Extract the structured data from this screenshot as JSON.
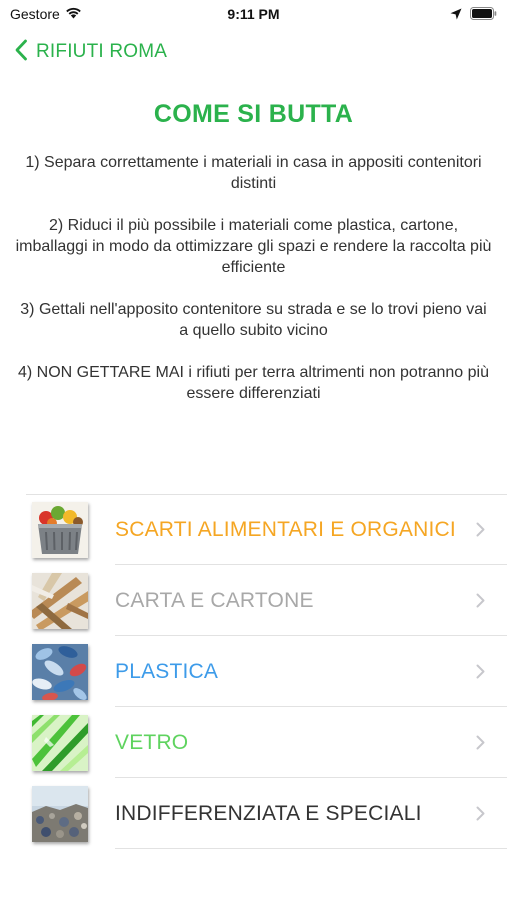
{
  "status": {
    "carrier": "Gestore",
    "time": "9:11 PM"
  },
  "nav": {
    "back_label": "RIFIUTI ROMA"
  },
  "title": "COME SI BUTTA",
  "instructions": [
    "1) Separa correttamente i materiali in casa in appositi contenitori distinti",
    "2) Riduci il più possibile i materiali come plastica, cartone, imballaggi in modo da ottimizzare gli spazi e rendere la raccolta più efficiente",
    "3) Gettali nell'apposito contenitore su strada e se lo trovi pieno vai a quello subito vicino",
    "4) NON GETTARE MAI i rifiuti per terra altrimenti non potranno più essere differenziati"
  ],
  "categories": [
    {
      "label": "SCARTI ALIMENTARI E ORGANICI",
      "color": "#f5a623",
      "icon": "organic-bin-icon"
    },
    {
      "label": "CARTA E CARTONE",
      "color": "#a8a8a8",
      "icon": "cardboard-icon"
    },
    {
      "label": "PLASTICA",
      "color": "#3d9be9",
      "icon": "plastic-bottles-icon"
    },
    {
      "label": "VETRO",
      "color": "#5fd35f",
      "icon": "glass-icon"
    },
    {
      "label": "INDIFFERENZIATA E SPECIALI",
      "color": "#333333",
      "icon": "landfill-icon"
    }
  ],
  "colors": {
    "accent": "#2bb24c",
    "separator": "#e2e2e2",
    "chevron": "#c7c7cc"
  }
}
